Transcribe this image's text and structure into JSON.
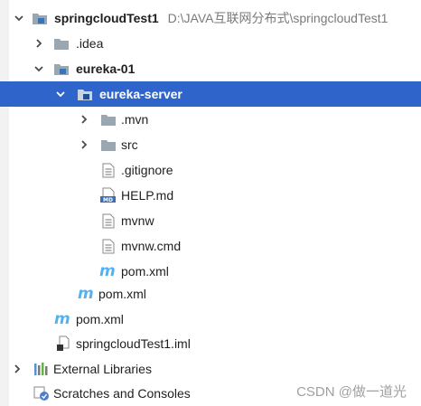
{
  "project_tree": {
    "root": {
      "label": "springcloudTest1",
      "path": "D:\\JAVA互联网分布式\\springcloudTest1"
    },
    "idea": {
      "label": ".idea"
    },
    "eureka_01": {
      "label": "eureka-01"
    },
    "eureka_server": {
      "label": "eureka-server"
    },
    "mvn": {
      "label": ".mvn"
    },
    "src": {
      "label": "src"
    },
    "gitignore": {
      "label": ".gitignore"
    },
    "help_md": {
      "label": "HELP.md",
      "badge": "MD"
    },
    "mvnw": {
      "label": "mvnw"
    },
    "mvnw_cmd": {
      "label": "mvnw.cmd"
    },
    "pom_server": {
      "label": "pom.xml"
    },
    "pom_eureka01": {
      "label": "pom.xml"
    },
    "pom_root": {
      "label": "pom.xml"
    },
    "iml": {
      "label": "springcloudTest1.iml"
    },
    "external_libraries": {
      "label": "External Libraries"
    },
    "scratches": {
      "label": "Scratches and Consoles"
    }
  },
  "watermark": "CSDN @做一道光",
  "colors": {
    "selection": "#2f65ca",
    "folder": "#9aa7b0",
    "maven_m": "#4fb3f2"
  }
}
